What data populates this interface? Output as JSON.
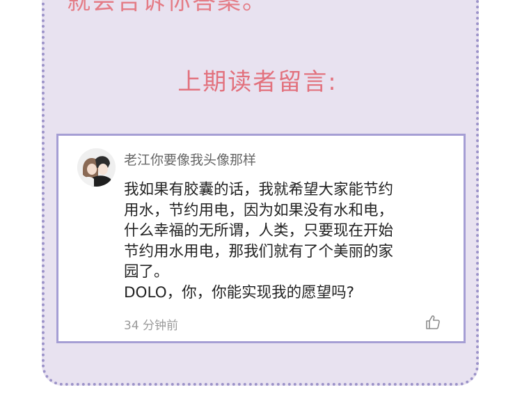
{
  "header": {
    "top_text": "就会告诉你答案。",
    "section_title": "上期读者留言:"
  },
  "comment": {
    "username": "老江你要像我头像那样",
    "body": "我如果有胶囊的话，我就希望大家能节约\n用水，节约用电，因为如果没有水和电，\n什么幸福的无所谓，人类，只要现在开始\n节约用水用电，那我们就有了个美丽的家\n园了。\nDOLO，你，你能实现我的愿望吗?",
    "time": "34 分钟前"
  },
  "colors": {
    "panel_bg": "#e8e2f0",
    "panel_border": "#9c93c9",
    "title_color": "#e2717d",
    "card_border": "#a59ed4"
  },
  "icons": {
    "like": "thumbs-up-icon",
    "avatar": "user-avatar"
  }
}
